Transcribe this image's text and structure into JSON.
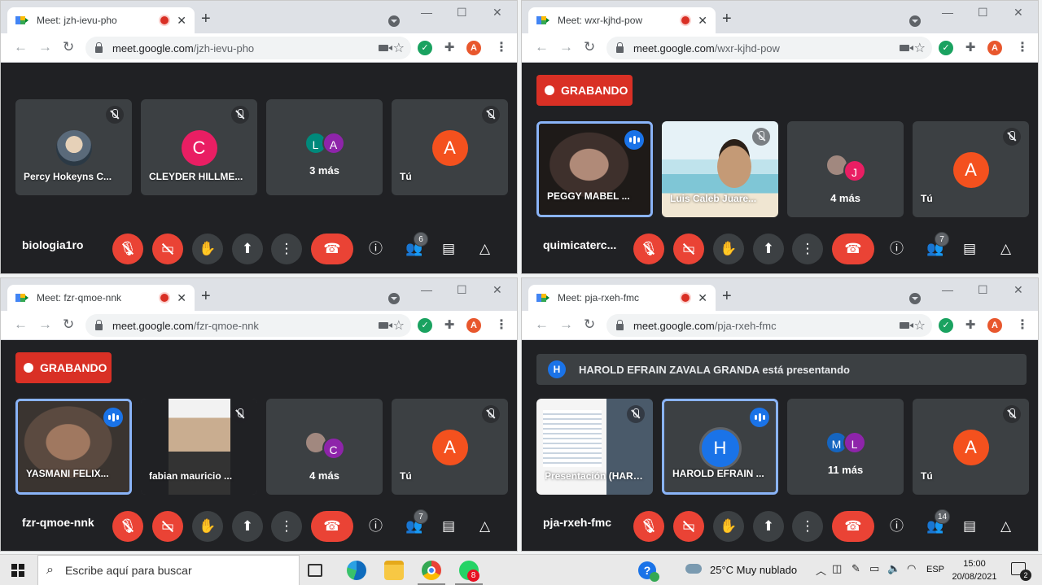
{
  "windows": [
    {
      "tab_title": "Meet: jzh-ievu-pho",
      "url_host": "meet.google.com",
      "url_path": "/jzh-ievu-pho",
      "profile_initial": "A",
      "recording": false,
      "presenting": null,
      "meeting_title": "biologia1ro",
      "participants_count": "6",
      "tiles": [
        {
          "name": "Percy Hokeyns C...",
          "kind": "photo-avatar",
          "muted": true
        },
        {
          "name": "CLEYDER HILLME...",
          "kind": "avatar",
          "initial": "C",
          "color": "#e91e63",
          "muted": true
        },
        {
          "name": "3 más",
          "kind": "more",
          "initials": [
            "L",
            "A"
          ],
          "colors": [
            "#00897b",
            "#8e24aa"
          ]
        },
        {
          "name": "Tú",
          "kind": "avatar",
          "initial": "A",
          "color": "#f4511e",
          "muted": true
        }
      ]
    },
    {
      "tab_title": "Meet: wxr-kjhd-pow",
      "url_host": "meet.google.com",
      "url_path": "/wxr-kjhd-pow",
      "profile_initial": "A",
      "recording": true,
      "recording_label": "GRABANDO",
      "presenting": null,
      "meeting_title": "quimicaterc...",
      "participants_count": "7",
      "tiles": [
        {
          "name": "PEGGY MABEL ...",
          "kind": "video-peggy",
          "speaking": true
        },
        {
          "name": "Luis Caleb Juare...",
          "kind": "video-luis",
          "muted": true
        },
        {
          "name": "4 más",
          "kind": "more",
          "initials": [
            "",
            "J"
          ],
          "colors": [
            "#a1887f",
            "#e91e63"
          ]
        },
        {
          "name": "Tú",
          "kind": "avatar",
          "initial": "A",
          "color": "#f4511e",
          "muted": true
        }
      ]
    },
    {
      "tab_title": "Meet: fzr-qmoe-nnk",
      "url_host": "meet.google.com",
      "url_path": "/fzr-qmoe-nnk",
      "profile_initial": "A",
      "recording": true,
      "recording_label": "GRABANDO",
      "presenting": null,
      "meeting_title": "fzr-qmoe-nnk",
      "participants_count": "7",
      "tiles": [
        {
          "name": "YASMANI FELIX...",
          "kind": "video-yasmani",
          "speaking": true
        },
        {
          "name": "fabian mauricio ...",
          "kind": "video-fabian",
          "muted": true
        },
        {
          "name": "4 más",
          "kind": "more",
          "initials": [
            "",
            "C"
          ],
          "colors": [
            "#a1887f",
            "#8e24aa"
          ]
        },
        {
          "name": "Tú",
          "kind": "avatar",
          "initial": "A",
          "color": "#f4511e",
          "muted": true
        }
      ]
    },
    {
      "tab_title": "Meet: pja-rxeh-fmc",
      "url_host": "meet.google.com",
      "url_path": "/pja-rxeh-fmc",
      "profile_initial": "A",
      "recording": false,
      "presenting": {
        "initial": "H",
        "text": "HAROLD EFRAIN ZAVALA GRANDA está presentando"
      },
      "meeting_title": "pja-rxeh-fmc",
      "participants_count": "14",
      "tiles": [
        {
          "name": "Presentación (HAROLD E...",
          "kind": "video-screen",
          "muted": true
        },
        {
          "name": "HAROLD EFRAIN ...",
          "kind": "avatar-blue",
          "initial": "H",
          "color": "#1a73e8",
          "speaking": true
        },
        {
          "name": "11 más",
          "kind": "more",
          "initials": [
            "M",
            "L"
          ],
          "colors": [
            "#1565c0",
            "#8e24aa"
          ]
        },
        {
          "name": "Tú",
          "kind": "avatar",
          "initial": "A",
          "color": "#f4511e",
          "muted": true
        }
      ]
    }
  ],
  "taskbar": {
    "search_placeholder": "Escribe aquí para buscar",
    "whatsapp_badge": "8",
    "weather": "25°C  Muy nublado",
    "language": "ESP",
    "time": "15:00",
    "date": "20/08/2021",
    "notifications": "2"
  }
}
